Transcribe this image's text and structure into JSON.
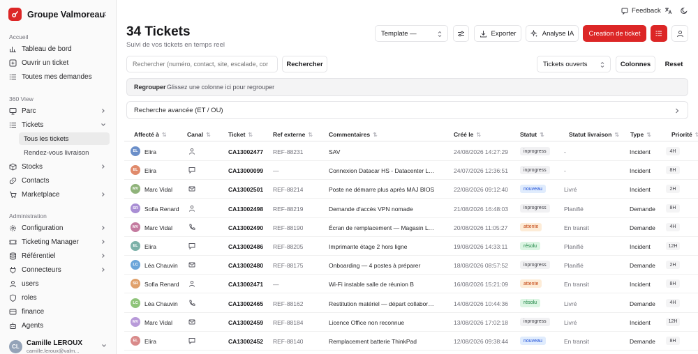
{
  "brand": {
    "name": "Groupe Valmoreau"
  },
  "sidebar": {
    "section_accueil": "Accueil",
    "accueil_items": [
      {
        "label": "Tableau de bord",
        "icon": "dashboard-icon"
      },
      {
        "label": "Ouvrir un ticket",
        "icon": "ticket-plus-icon"
      },
      {
        "label": "Toutes mes demandes",
        "icon": "list-icon"
      }
    ],
    "section_360": "360 View",
    "view_items": [
      {
        "label": "Parc",
        "icon": "monitor-icon"
      },
      {
        "label": "Tickets",
        "icon": "list-icon"
      }
    ],
    "tickets_sub": [
      {
        "label": "Tous les tickets",
        "active": true
      },
      {
        "label": "Rendez-vous livraison",
        "active": false
      }
    ],
    "view_items_2": [
      {
        "label": "Stocks",
        "icon": "box-icon"
      },
      {
        "label": "Contacts",
        "icon": "link-icon"
      },
      {
        "label": "Marketplace",
        "icon": "cart-icon"
      }
    ],
    "section_admin": "Administration",
    "admin_items": [
      {
        "label": "Configuration",
        "icon": "gear-icon"
      },
      {
        "label": "Ticketing Manager",
        "icon": "ticketing-icon"
      },
      {
        "label": "Référentiel",
        "icon": "database-icon"
      },
      {
        "label": "Connecteurs",
        "icon": "plug-icon"
      },
      {
        "label": "users",
        "icon": "user-icon"
      },
      {
        "label": "roles",
        "icon": "shield-icon"
      },
      {
        "label": "finance",
        "icon": "card-icon"
      },
      {
        "label": "Agents",
        "icon": "bot-icon"
      }
    ],
    "user": {
      "initials": "CL",
      "name": "Camille LEROUX",
      "email": "camille.leroux@valm..."
    }
  },
  "header": {
    "feedback_label": "Feedback",
    "title": "34 Tickets",
    "subtitle": "Suivi de vos tickets en temps reel",
    "template_value": "Template —",
    "export_label": "Exporter",
    "ai_label": "Analyse IA",
    "create_label": "Creation de ticket"
  },
  "filters": {
    "search_placeholder": "Rechercher (numéro, contact, site, escalade, cor",
    "search_button": "Rechercher",
    "status_value": "Tickets ouverts",
    "columns_label": "Colonnes",
    "reset_label": "Reset",
    "group_label": "Regrouper",
    "group_hint": "Glissez une colonne ici pour regrouper",
    "advanced_label": "Recherche avancée (ET / OU)"
  },
  "table": {
    "headers": [
      "Affecté à",
      "Canal",
      "Ticket",
      "Ref externe",
      "Commentaires",
      "Créé le",
      "Statut",
      "Statut livraison",
      "Type",
      "Priorité"
    ],
    "rows": [
      {
        "initials": "EL",
        "avatar_color": "#6b8fc9",
        "assignee": "Elira",
        "channel": "person",
        "ticket": "CA13002477",
        "ref": "REF-88231",
        "comment": "SAV",
        "created": "24/08/2026 14:27:29",
        "status": "inprogress",
        "delivery": "-",
        "type": "Incident",
        "priority": "4H"
      },
      {
        "initials": "EL",
        "avatar_color": "#e08a6b",
        "assignee": "Elira",
        "channel": "chat",
        "ticket": "CA13000099",
        "ref": "—",
        "comment": "Connexion Datacar HS - Datacenter Lyon...",
        "created": "24/07/2026 12:36:51",
        "status": "inprogress",
        "delivery": "-",
        "type": "Incident",
        "priority": "8H"
      },
      {
        "initials": "MV",
        "avatar_color": "#8fb37a",
        "assignee": "Marc Vidal",
        "channel": "mail",
        "ticket": "CA13002501",
        "ref": "REF-88214",
        "comment": "Poste ne démarre plus après MAJ BIOS",
        "created": "22/08/2026 09:12:40",
        "status": "nouveau",
        "delivery": "Livré",
        "type": "Incident",
        "priority": "2H"
      },
      {
        "initials": "SR",
        "avatar_color": "#a98ed4",
        "assignee": "Sofia Renard",
        "channel": "person",
        "ticket": "CA13002498",
        "ref": "REF-88219",
        "comment": "Demande d'accès VPN nomade",
        "created": "21/08/2026 16:48:03",
        "status": "inprogress",
        "delivery": "Planifié",
        "type": "Demande",
        "priority": "8H"
      },
      {
        "initials": "MV",
        "avatar_color": "#c47a9f",
        "assignee": "Marc Vidal",
        "channel": "phone",
        "ticket": "CA13002490",
        "ref": "REF-88190",
        "comment": "Écran de remplacement — Magasin Lyon",
        "created": "20/08/2026 11:05:27",
        "status": "attente",
        "delivery": "En transit",
        "type": "Demande",
        "priority": "4H"
      },
      {
        "initials": "EL",
        "avatar_color": "#7cb1a8",
        "assignee": "Elira",
        "channel": "chat",
        "ticket": "CA13002486",
        "ref": "REF-88205",
        "comment": "Imprimante étage 2 hors ligne",
        "created": "19/08/2026 14:33:11",
        "status": "résolu",
        "delivery": "Planifié",
        "type": "Incident",
        "priority": "12H"
      },
      {
        "initials": "LC",
        "avatar_color": "#6ba5d9",
        "assignee": "Léa Chauvin",
        "channel": "mail",
        "ticket": "CA13002480",
        "ref": "REF-88175",
        "comment": "Onboarding — 4 postes à préparer",
        "created": "18/08/2026 08:57:52",
        "status": "inprogress",
        "delivery": "Planifié",
        "type": "Demande",
        "priority": "2H"
      },
      {
        "initials": "SR",
        "avatar_color": "#e0a06b",
        "assignee": "Sofia Renard",
        "channel": "person",
        "ticket": "CA13002471",
        "ref": "—",
        "comment": "Wi-Fi instable salle de réunion B",
        "created": "16/08/2026 15:21:09",
        "status": "attente",
        "delivery": "En transit",
        "type": "Incident",
        "priority": "8H"
      },
      {
        "initials": "LC",
        "avatar_color": "#8fc47a",
        "assignee": "Léa Chauvin",
        "channel": "phone",
        "ticket": "CA13002465",
        "ref": "REF-88162",
        "comment": "Restitution matériel — départ collaborateur",
        "created": "14/08/2026 10:44:36",
        "status": "résolu",
        "delivery": "Livré",
        "type": "Demande",
        "priority": "4H"
      },
      {
        "initials": "MV",
        "avatar_color": "#b89ad9",
        "assignee": "Marc Vidal",
        "channel": "mail",
        "ticket": "CA13002459",
        "ref": "REF-88184",
        "comment": "Licence Office non reconnue",
        "created": "13/08/2026 17:02:18",
        "status": "inprogress",
        "delivery": "Livré",
        "type": "Incident",
        "priority": "12H"
      },
      {
        "initials": "EL",
        "avatar_color": "#d98a8a",
        "assignee": "Elira",
        "channel": "chat",
        "ticket": "CA13002452",
        "ref": "REF-88140",
        "comment": "Remplacement batterie ThinkPad",
        "created": "12/08/2026 09:38:44",
        "status": "nouveau",
        "delivery": "En transit",
        "type": "Demande",
        "priority": "8H"
      }
    ]
  },
  "status_colors": {
    "inprogress": {
      "bg": "#f1f1f3",
      "fg": "#3f3f46"
    },
    "nouveau": {
      "bg": "#e0ecfd",
      "fg": "#1d4ed8"
    },
    "attente": {
      "bg": "#fdecd7",
      "fg": "#c2410c"
    },
    "résolu": {
      "bg": "#dcf5e3",
      "fg": "#15803d"
    }
  },
  "accent_color": "#dc2626"
}
